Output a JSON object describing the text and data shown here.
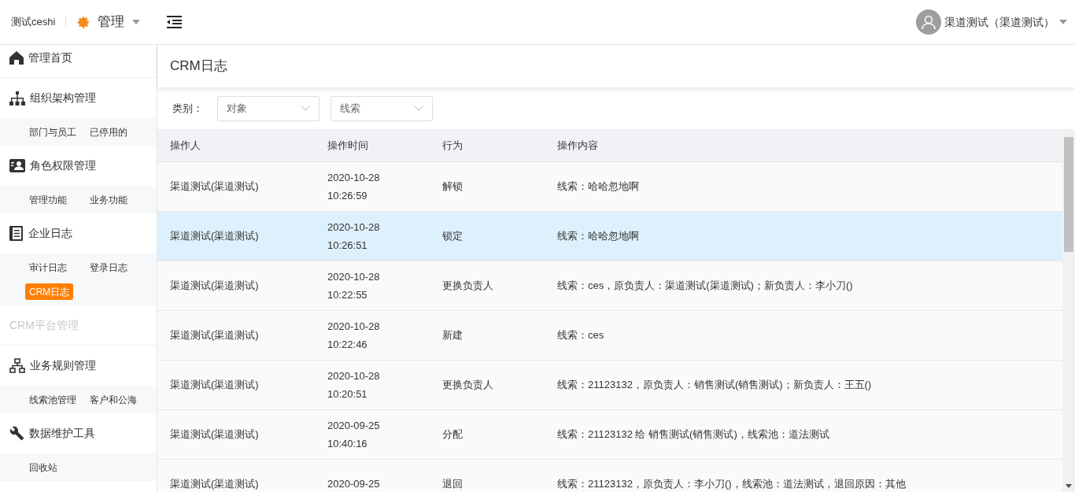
{
  "header": {
    "brand": "测试ceshi",
    "module": "管理",
    "user": "渠道测试（渠道测试）"
  },
  "sidebar": {
    "sections": [
      {
        "label": "管理首页",
        "disabled": false
      },
      {
        "label": "组织架构管理",
        "disabled": false,
        "children": [
          {
            "label": "部门与员工",
            "selected": false
          },
          {
            "label": "已停用的",
            "selected": false
          }
        ]
      },
      {
        "label": "角色权限管理",
        "disabled": false,
        "children": [
          {
            "label": "管理功能",
            "selected": false
          },
          {
            "label": "业务功能",
            "selected": false
          }
        ]
      },
      {
        "label": "企业日志",
        "disabled": false,
        "children": [
          {
            "label": "审计日志",
            "selected": false
          },
          {
            "label": "登录日志",
            "selected": false
          },
          {
            "label": "CRM日志",
            "selected": true
          }
        ]
      },
      {
        "label": "CRM平台管理",
        "disabled": true
      },
      {
        "label": "业务规则管理",
        "disabled": false,
        "children": [
          {
            "label": "线索池管理",
            "selected": false
          },
          {
            "label": "客户和公海",
            "selected": false
          }
        ]
      },
      {
        "label": "数据维护工具",
        "disabled": false,
        "children": [
          {
            "label": "回收站",
            "selected": false
          }
        ]
      }
    ]
  },
  "page": {
    "title": "CRM日志"
  },
  "filters": {
    "label": "类别：",
    "selects": [
      {
        "value": "对象"
      },
      {
        "value": "线索"
      }
    ]
  },
  "table": {
    "columns": [
      "操作人",
      "操作时间",
      "行为",
      "操作内容"
    ],
    "rows": [
      {
        "operator": "渠道测试(渠道测试)",
        "date": "2020-10-28",
        "time": "10:26:59",
        "action": "解锁",
        "content": "线索：哈哈忽地啊",
        "selected": false
      },
      {
        "operator": "渠道测试(渠道测试)",
        "date": "2020-10-28",
        "time": "10:26:51",
        "action": "锁定",
        "content": "线索：哈哈忽地啊",
        "selected": true
      },
      {
        "operator": "渠道测试(渠道测试)",
        "date": "2020-10-28",
        "time": "10:22:55",
        "action": "更换负责人",
        "content": "线索：ces，原负责人：渠道测试(渠道测试)；新负责人：李小刀()",
        "selected": false
      },
      {
        "operator": "渠道测试(渠道测试)",
        "date": "2020-10-28",
        "time": "10:22:46",
        "action": "新建",
        "content": "线索：ces",
        "selected": false
      },
      {
        "operator": "渠道测试(渠道测试)",
        "date": "2020-10-28",
        "time": "10:20:51",
        "action": "更换负责人",
        "content": "线索：21123132，原负责人：销售测试(销售测试)；新负责人：王五()",
        "selected": false
      },
      {
        "operator": "渠道测试(渠道测试)",
        "date": "2020-09-25",
        "time": "10:40:16",
        "action": "分配",
        "content": "线索：21123132 给 销售测试(销售测试)，线索池：道法测试",
        "selected": false
      },
      {
        "operator": "渠道测试(渠道测试)",
        "date": "2020-09-25",
        "action": "退回",
        "content": "线索：21123132，原负责人：李小刀()，线索池：道法测试，退回原因：其他",
        "selected": false
      }
    ]
  }
}
